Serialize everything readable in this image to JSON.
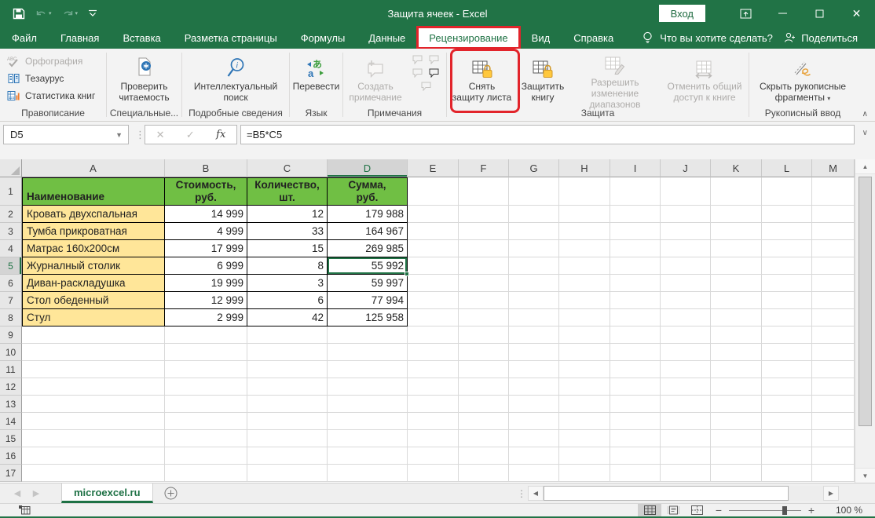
{
  "window": {
    "title": "Защита ячеек  -  Excel",
    "sign_in_label": "Вход"
  },
  "menu_tabs": {
    "items": [
      "Файл",
      "Главная",
      "Вставка",
      "Разметка страницы",
      "Формулы",
      "Данные",
      "Рецензирование",
      "Вид",
      "Справка"
    ],
    "selected": "Рецензирование",
    "tell_me": "Что вы хотите сделать?",
    "share_label": "Поделиться"
  },
  "ribbon": {
    "spelling": {
      "items": [
        "Орфография",
        "Тезаурус",
        "Статистика книг"
      ],
      "group_label": "Правописание"
    },
    "accessibility": {
      "button_label": "Проверить\nчитаемость",
      "group_label": "Специальные..."
    },
    "insights": {
      "button_label": "Интеллектуальный\nпоиск",
      "group_label": "Подробные сведения"
    },
    "language": {
      "button_label": "Перевести",
      "group_label": "Язык"
    },
    "comments": {
      "button_label": "Создать\nпримечание",
      "group_label": "Примечания"
    },
    "protection": {
      "unprotect_sheet_label": "Снять\nзащиту листа",
      "protect_workbook_label": "Защитить\nкнигу",
      "allow_ranges_label": "Разрешить изменение\nдиапазонов",
      "unshare_label": "Отменить общий\nдоступ к книге",
      "group_label": "Защита"
    },
    "ink": {
      "button_label": "Скрыть рукописные\nфрагменты",
      "group_label": "Рукописный ввод"
    }
  },
  "formula_bar": {
    "name_box": "D5",
    "formula": "=B5*C5"
  },
  "sheet": {
    "columns": [
      "A",
      "B",
      "C",
      "D",
      "E",
      "F",
      "G",
      "H",
      "I",
      "J",
      "K",
      "L",
      "M"
    ],
    "rows": [
      "1",
      "2",
      "3",
      "4",
      "5",
      "6",
      "7",
      "8",
      "9",
      "10",
      "11",
      "12",
      "13",
      "14",
      "15",
      "16",
      "17"
    ],
    "selected_cell": "D5",
    "selected_column": "D",
    "selected_row": "5",
    "table": {
      "headers": [
        "Наименование",
        "Стоимость,\nруб.",
        "Количество,\nшт.",
        "Сумма,\nруб."
      ],
      "rows": [
        [
          "Кровать двухспальная",
          "14 999",
          "12",
          "179 988"
        ],
        [
          "Тумба прикроватная",
          "4 999",
          "33",
          "164 967"
        ],
        [
          "Матрас 160х200см",
          "17 999",
          "15",
          "269 985"
        ],
        [
          "Журналный столик",
          "6 999",
          "8",
          "55 992"
        ],
        [
          "Диван-раскладушка",
          "19 999",
          "3",
          "59 997"
        ],
        [
          "Стол обеденный",
          "12 999",
          "6",
          "77 994"
        ],
        [
          "Стул",
          "2 999",
          "42",
          "125 958"
        ]
      ]
    }
  },
  "sheet_tabs": {
    "active_tab": "microexcel.ru"
  },
  "status_bar": {
    "zoom_level": "100 %"
  },
  "colors": {
    "excel_green": "#217346",
    "highlight_red": "#E2242B",
    "table_header_green": "#70BF44",
    "table_name_yellow": "#FFE699"
  }
}
